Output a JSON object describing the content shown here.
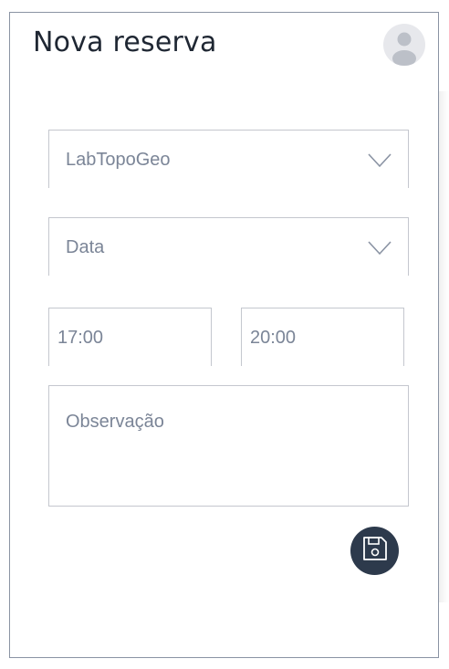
{
  "header": {
    "title": "Nova reserva"
  },
  "form": {
    "lab_select": {
      "value": "LabTopoGeo"
    },
    "date_select": {
      "placeholder": "Data"
    },
    "time_start": {
      "value": "17:00"
    },
    "time_end": {
      "value": "20:00"
    },
    "observation": {
      "placeholder": "Observação"
    }
  },
  "icons": {
    "avatar": "user-avatar-icon",
    "chevron": "chevron-down-icon",
    "save": "floppy-disk-icon"
  },
  "colors": {
    "title": "#1f2733",
    "field_text": "#7b8597",
    "field_border": "#c4c7ce",
    "save_button": "#2d3a4c",
    "frame_border": "#8a93a3"
  }
}
